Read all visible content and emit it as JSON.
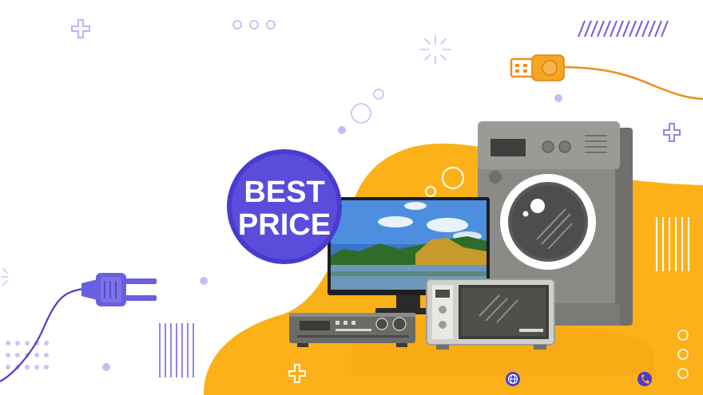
{
  "badge": {
    "line1": "BEST",
    "line2": "PRICE"
  },
  "icons": {
    "globe": "globe-icon",
    "phone": "phone-icon",
    "plug": "power-plug-icon",
    "usb": "usb-connector-icon",
    "plus": "plus-icon"
  },
  "colors": {
    "accent_purple": "#5b4cdb",
    "accent_orange": "#f5a623",
    "blob_orange": "#fbb117",
    "appliance_gray": "#8a8b86",
    "lavender": "#c9c6f3"
  }
}
